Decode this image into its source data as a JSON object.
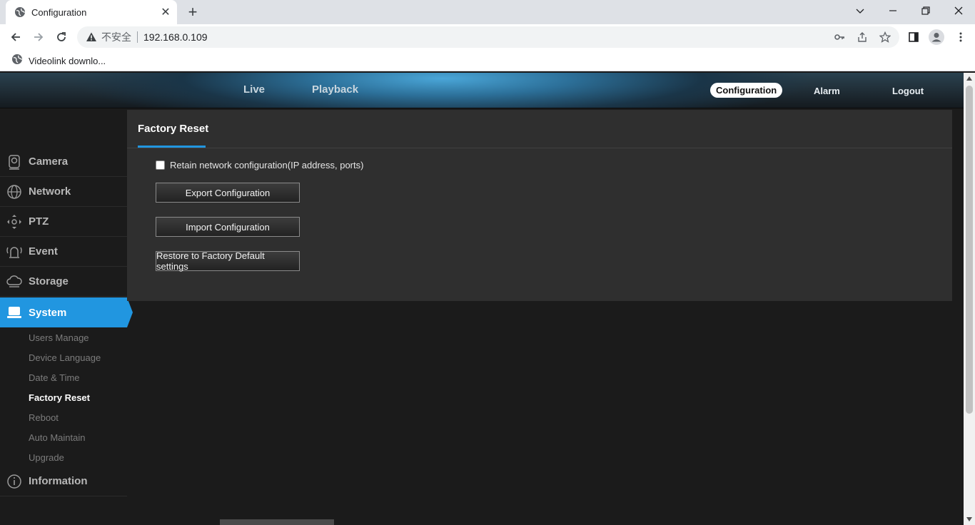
{
  "browser": {
    "tab_title": "Configuration",
    "insecure_label": "不安全",
    "url": "192.168.0.109",
    "bookmark_label": "Videolink downlo..."
  },
  "topnav": {
    "live": "Live",
    "playback": "Playback",
    "configuration": "Configuration",
    "alarm": "Alarm",
    "logout": "Logout"
  },
  "sidebar": {
    "items": [
      {
        "label": "Camera",
        "icon": "camera-icon"
      },
      {
        "label": "Network",
        "icon": "network-icon"
      },
      {
        "label": "PTZ",
        "icon": "ptz-icon"
      },
      {
        "label": "Event",
        "icon": "event-icon"
      },
      {
        "label": "Storage",
        "icon": "storage-icon"
      },
      {
        "label": "System",
        "icon": "system-icon"
      },
      {
        "label": "Information",
        "icon": "info-icon"
      }
    ],
    "system_sub": [
      "Users Manage",
      "Device Language",
      "Date & Time",
      "Factory Reset",
      "Reboot",
      "Auto Maintain",
      "Upgrade"
    ]
  },
  "panel": {
    "title": "Factory Reset",
    "retain_label": "Retain network configuration(IP address, ports)",
    "retain_checked": false,
    "export_label": "Export Configuration",
    "import_label": "Import Configuration",
    "restore_label": "Restore to Factory Default settings"
  },
  "colors": {
    "accent": "#2196e0",
    "panel_bg": "#2f2f2f",
    "page_bg": "#1b1b1b"
  }
}
